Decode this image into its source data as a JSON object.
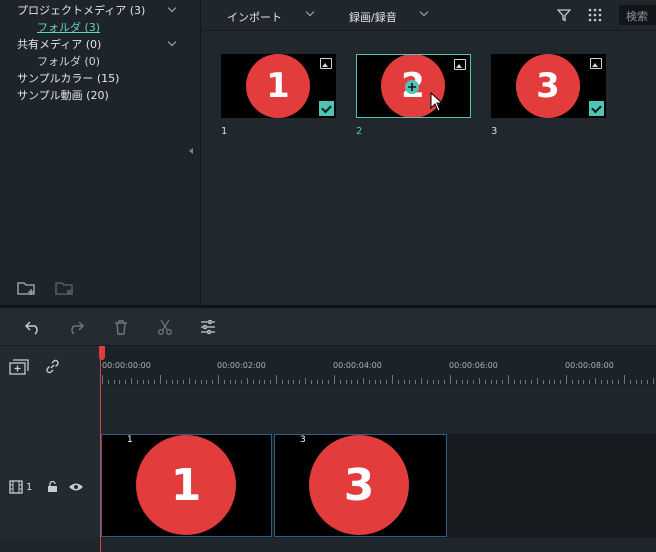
{
  "sidebar": {
    "project_media": "プロジェクトメディア (3)",
    "folder_active": "フォルダ (3)",
    "shared_media": "共有メディア (0)",
    "folder_shared": "フォルダ (0)",
    "sample_color": "サンプルカラー (15)",
    "sample_video": "サンプル動画 (20)"
  },
  "toolbar": {
    "import_label": "インポート",
    "record_label": "録画/録音",
    "search_placeholder": "検索"
  },
  "media": [
    {
      "number": "1",
      "label": "1",
      "selected": false,
      "checked": true
    },
    {
      "number": "2",
      "label": "2",
      "selected": true,
      "checked": false
    },
    {
      "number": "3",
      "label": "3",
      "selected": false,
      "checked": true
    }
  ],
  "timeline": {
    "timecodes": [
      "00:00:00:00",
      "00:00:02:00",
      "00:00:04:00",
      "00:00:06:00",
      "00:00:08:00"
    ],
    "track_number": "1",
    "clips": [
      {
        "label": "1",
        "number": "1"
      },
      {
        "label": "3",
        "number": "3"
      }
    ]
  },
  "colors": {
    "accent": "#4fc4b5",
    "clip_red": "#e23c3c",
    "playhead": "#e23c3c"
  }
}
